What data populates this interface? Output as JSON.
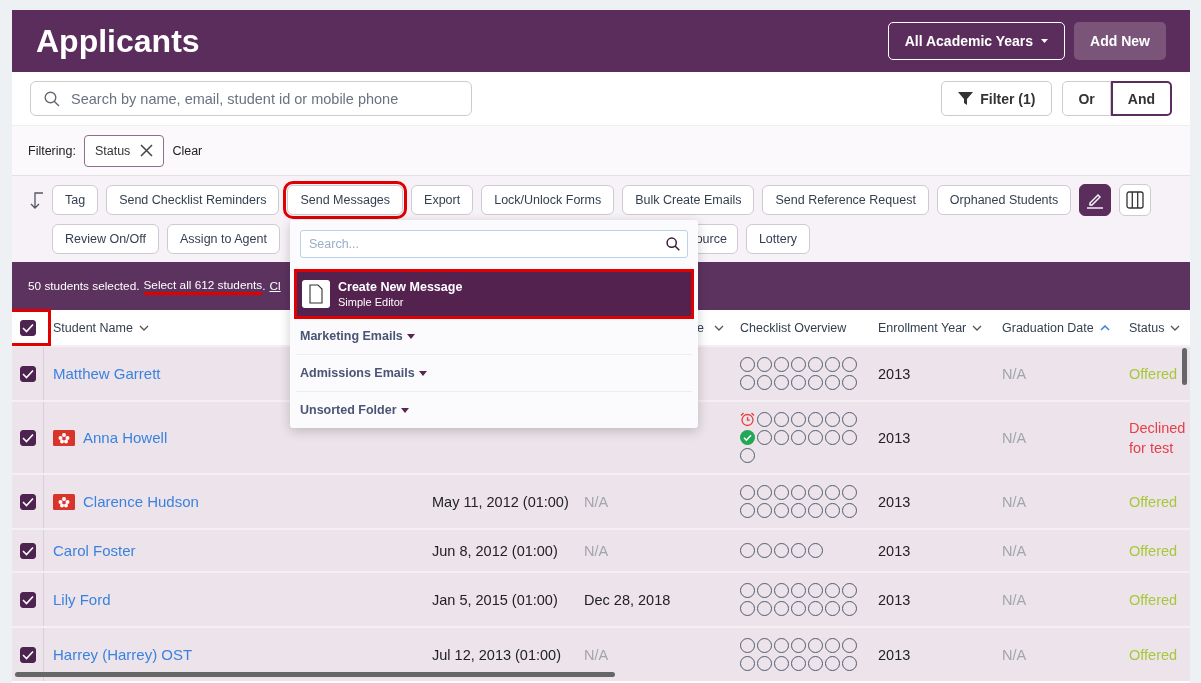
{
  "header": {
    "title": "Applicants",
    "year_filter": "All Academic Years",
    "add_button": "Add New"
  },
  "search": {
    "placeholder": "Search by name, email, student id or mobile phone"
  },
  "filter_button": "Filter (1)",
  "logic_toggle": [
    {
      "label": "Or",
      "selected": false
    },
    {
      "label": "And",
      "selected": true
    }
  ],
  "filtering": {
    "label": "Filtering:",
    "chips": [
      "Status"
    ],
    "clear": "Clear"
  },
  "toolbar": {
    "buttons": [
      {
        "label": "Tag",
        "highlighted": false
      },
      {
        "label": "Send Checklist Reminders",
        "highlighted": false
      },
      {
        "label": "Send Messages",
        "highlighted": true
      },
      {
        "label": "Export",
        "highlighted": false
      },
      {
        "label": "Lock/Unlock Forms",
        "highlighted": false
      },
      {
        "label": "Bulk Create Emails",
        "highlighted": false
      },
      {
        "label": "Send Reference Request",
        "highlighted": false
      },
      {
        "label": "Orphaned Students",
        "highlighted": false
      },
      {
        "label": "Review On/Off",
        "highlighted": false
      },
      {
        "label": "Assign to Agent",
        "highlighted": false
      },
      {
        "label": "ource",
        "highlighted": false,
        "partial": true
      },
      {
        "label": "Lottery",
        "highlighted": false
      }
    ],
    "tool_buttons": [
      {
        "kind": "edit",
        "on": true
      },
      {
        "kind": "columns",
        "on": false
      }
    ]
  },
  "selection_bar": {
    "text": "50 students selected.",
    "select_all": "Select all 612 students",
    "select_all_highlighted": true,
    "separator": ".",
    "clear_link": "Cl"
  },
  "table": {
    "select_all_checked": true,
    "select_all_highlighted": true,
    "columns": [
      {
        "label": "Student Name",
        "kind": "sortable"
      },
      {
        "label": "e",
        "kind": "sortable"
      },
      {
        "label": "Checklist Overview",
        "kind": "plain"
      },
      {
        "label": "Enrollment Year",
        "kind": "sortable"
      },
      {
        "label": "Graduation Date",
        "kind": "sorted"
      },
      {
        "label": "Status",
        "kind": "sortable"
      }
    ],
    "rows": [
      {
        "checked": true,
        "name": "Matthew Garrett",
        "flag": false,
        "checklist": [
          {
            "kind": "open"
          },
          {
            "kind": "open"
          },
          {
            "kind": "open"
          },
          {
            "kind": "open"
          },
          {
            "kind": "open"
          },
          {
            "kind": "open"
          },
          {
            "kind": "open"
          },
          {
            "kind": "open"
          },
          {
            "kind": "open"
          },
          {
            "kind": "open"
          },
          {
            "kind": "open"
          },
          {
            "kind": "open"
          },
          {
            "kind": "open"
          },
          {
            "kind": "open"
          }
        ],
        "enrollment_year": "2013",
        "graduation_date": {
          "text": "N/A",
          "muted": true
        },
        "status": {
          "text": "Offered",
          "kind": "offered"
        }
      },
      {
        "checked": true,
        "name": "Anna Howell",
        "flag": true,
        "checklist": [
          {
            "kind": "alarm"
          },
          {
            "kind": "open"
          },
          {
            "kind": "open"
          },
          {
            "kind": "open"
          },
          {
            "kind": "open"
          },
          {
            "kind": "open"
          },
          {
            "kind": "open"
          },
          {
            "kind": "done"
          },
          {
            "kind": "open"
          },
          {
            "kind": "open"
          },
          {
            "kind": "open"
          },
          {
            "kind": "open"
          },
          {
            "kind": "open"
          },
          {
            "kind": "open"
          },
          {
            "kind": "open"
          }
        ],
        "enrollment_year": "2013",
        "graduation_date": {
          "text": "N/A",
          "muted": true
        },
        "status": {
          "text": "Declined for test",
          "kind": "declined"
        }
      },
      {
        "checked": true,
        "name": "Clarence Hudson",
        "flag": true,
        "date": "May 11, 2012 (01:00)",
        "column_3": {
          "text": "N/A",
          "muted": true
        },
        "checklist": [
          {
            "kind": "open"
          },
          {
            "kind": "open"
          },
          {
            "kind": "open"
          },
          {
            "kind": "open"
          },
          {
            "kind": "open"
          },
          {
            "kind": "open"
          },
          {
            "kind": "open"
          },
          {
            "kind": "open"
          },
          {
            "kind": "open"
          },
          {
            "kind": "open"
          },
          {
            "kind": "open"
          },
          {
            "kind": "open"
          },
          {
            "kind": "open"
          },
          {
            "kind": "open"
          }
        ],
        "enrollment_year": "2013",
        "graduation_date": {
          "text": "N/A",
          "muted": true
        },
        "status": {
          "text": "Offered",
          "kind": "offered"
        }
      },
      {
        "checked": true,
        "name": "Carol Foster",
        "flag": false,
        "date": "Jun 8, 2012 (01:00)",
        "column_3": {
          "text": "N/A",
          "muted": true
        },
        "checklist": [
          {
            "kind": "open"
          },
          {
            "kind": "open"
          },
          {
            "kind": "open"
          },
          {
            "kind": "open"
          },
          {
            "kind": "open"
          }
        ],
        "enrollment_year": "2013",
        "graduation_date": {
          "text": "N/A",
          "muted": true
        },
        "status": {
          "text": "Offered",
          "kind": "offered"
        }
      },
      {
        "checked": true,
        "name": "Lily Ford",
        "flag": false,
        "date": "Jan 5, 2015 (01:00)",
        "column_3": {
          "text": "Dec 28, 2018",
          "muted": false
        },
        "checklist": [
          {
            "kind": "open"
          },
          {
            "kind": "open"
          },
          {
            "kind": "open"
          },
          {
            "kind": "open"
          },
          {
            "kind": "open"
          },
          {
            "kind": "open"
          },
          {
            "kind": "open"
          },
          {
            "kind": "open"
          },
          {
            "kind": "open"
          },
          {
            "kind": "open"
          },
          {
            "kind": "open"
          },
          {
            "kind": "open"
          },
          {
            "kind": "open"
          },
          {
            "kind": "open"
          }
        ],
        "enrollment_year": "2013",
        "graduation_date": {
          "text": "N/A",
          "muted": true
        },
        "status": {
          "text": "Offered",
          "kind": "offered"
        }
      },
      {
        "checked": true,
        "name": "Harrey (Harrey) OST",
        "flag": false,
        "date": "Jul 12, 2013 (01:00)",
        "column_3": {
          "text": "N/A",
          "muted": true
        },
        "checklist": [
          {
            "kind": "open"
          },
          {
            "kind": "open"
          },
          {
            "kind": "open"
          },
          {
            "kind": "open"
          },
          {
            "kind": "open"
          },
          {
            "kind": "open"
          },
          {
            "kind": "open"
          },
          {
            "kind": "open"
          },
          {
            "kind": "open"
          },
          {
            "kind": "open"
          },
          {
            "kind": "open"
          },
          {
            "kind": "open"
          },
          {
            "kind": "open"
          },
          {
            "kind": "open"
          }
        ],
        "enrollment_year": "2013",
        "graduation_date": {
          "text": "N/A",
          "muted": true
        },
        "status": {
          "text": "Offered",
          "kind": "offered"
        }
      }
    ]
  },
  "message_menu": {
    "search_placeholder": "Search...",
    "items": [
      {
        "title": "Create New Message",
        "subtitle": "Simple Editor",
        "selected": true,
        "highlighted": true
      }
    ],
    "folders": [
      "Marketing Emails",
      "Admissions Emails",
      "Unsorted Folder"
    ]
  }
}
